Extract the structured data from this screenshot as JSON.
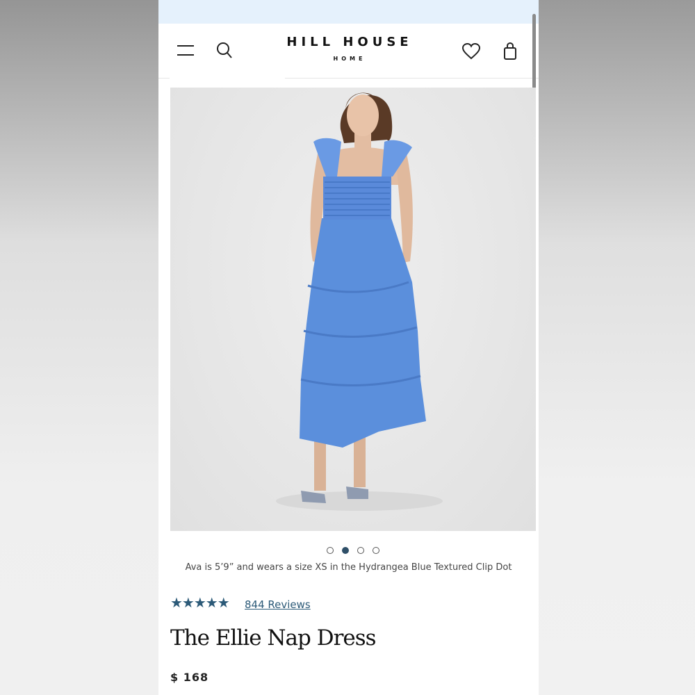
{
  "header": {
    "brand_main": "HILL HOUSE",
    "brand_sub": "HOME",
    "icons": [
      "menu-icon",
      "search-icon",
      "heart-icon",
      "shopping-bag-icon"
    ]
  },
  "gallery": {
    "image_alt": "Model wearing blue tiered smocked midi dress",
    "slide_count": 4,
    "active_slide": 2,
    "caption": "Ava is 5’9” and wears a size XS in the Hydrangea Blue Textured Clip Dot"
  },
  "product": {
    "stars": "★★★★★",
    "rating": 5,
    "reviews_link": "844 Reviews",
    "title": "The Ellie Nap Dress",
    "price": "$ 168"
  },
  "colors": {
    "accent": "#2c5a78",
    "announcement_bar": "#e5f1fc",
    "dress_blue": "#5b8fdc"
  }
}
